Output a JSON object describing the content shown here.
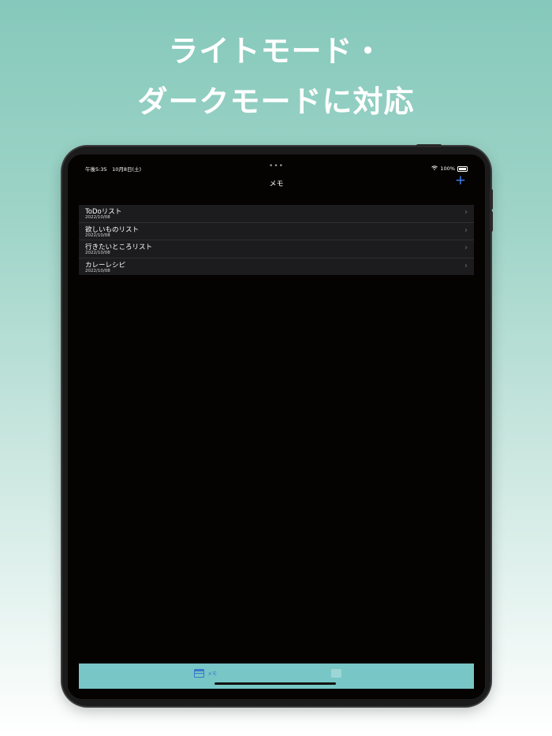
{
  "promo": {
    "headline_line1": "ライトモード・",
    "headline_line2": "ダークモードに対応"
  },
  "status_bar": {
    "time_date": "午後5:35　10月8日(土)",
    "dots": "•••",
    "wifi_icon": "wifi-icon",
    "battery_percent": "100%"
  },
  "navbar": {
    "title": "メモ",
    "add_label": "+"
  },
  "memo_list": [
    {
      "title": "ToDoリスト",
      "date": "2022/10/08"
    },
    {
      "title": "欲しいものリスト",
      "date": "2022/10/08"
    },
    {
      "title": "行きたいところリスト",
      "date": "2022/10/08"
    },
    {
      "title": "カレーレシピ",
      "date": "2022/10/08"
    }
  ],
  "tabbar": {
    "tabs": [
      {
        "label": "メモ",
        "icon": "memo-icon",
        "selected": true
      },
      {
        "label": "",
        "icon": "other-icon",
        "selected": false
      }
    ]
  },
  "colors": {
    "accent": "#3b82f6",
    "tabbar_bg": "#78c6c6",
    "screen_bg": "#050202",
    "list_bg": "#1c1c1e"
  }
}
